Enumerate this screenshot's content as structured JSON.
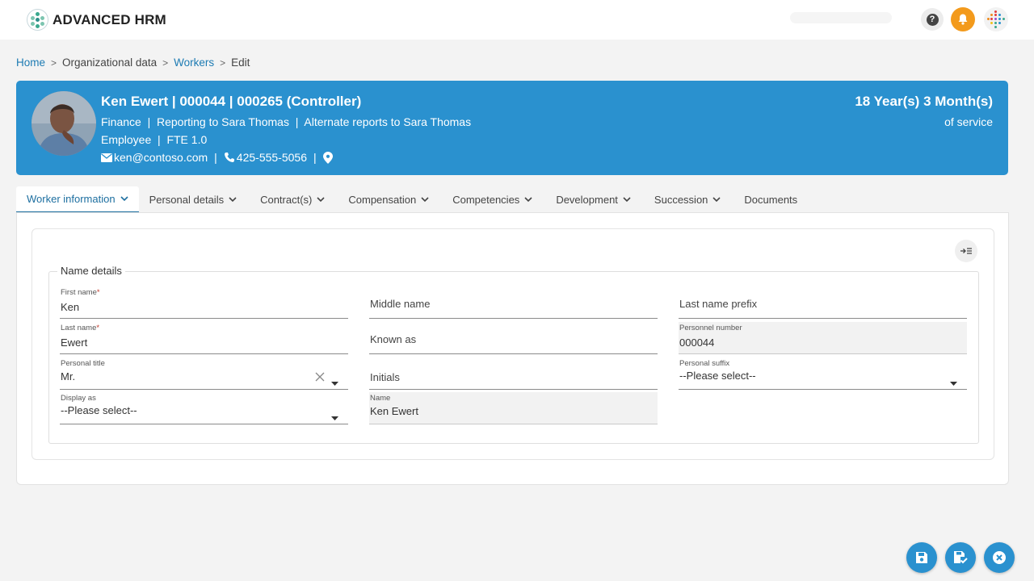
{
  "app": {
    "name": "ADVANCED HRM"
  },
  "topbar": {
    "help_icon": "question-icon",
    "notification_icon": "bell-icon",
    "apps_icon": "dot-grid-icon",
    "bell_color": "#f39a1c"
  },
  "breadcrumb": [
    {
      "label": "Home"
    },
    {
      "label": "Organizational data"
    },
    {
      "label": "Workers"
    },
    {
      "label": "Edit"
    }
  ],
  "worker": {
    "title": "Ken Ewert | 000044 | 000265 (Controller)",
    "org_line": "Finance  |  Reporting to Sara Thomas  |  Alternate reports to Sara Thomas",
    "type_line": "Employee  |  FTE 1.0",
    "email": "ken@contoso.com",
    "phone": "425-555-5056",
    "service_length": "18 Year(s) 3 Month(s)",
    "service_caption": "of service",
    "header_color": "#2a91cf"
  },
  "tabs": [
    {
      "label": "Worker information",
      "active": true
    },
    {
      "label": "Personal details"
    },
    {
      "label": "Contract(s)"
    },
    {
      "label": "Compensation"
    },
    {
      "label": "Competencies"
    },
    {
      "label": "Development"
    },
    {
      "label": "Succession"
    },
    {
      "label": "Documents"
    }
  ],
  "section": {
    "legend": "Name details",
    "fields": {
      "first_name": {
        "label": "First name",
        "value": "Ken",
        "required": "*"
      },
      "middle_name": {
        "placeholder": "Middle name"
      },
      "last_name_prefix": {
        "placeholder": "Last name prefix"
      },
      "last_name": {
        "label": "Last name",
        "value": "Ewert",
        "required": "*"
      },
      "known_as": {
        "placeholder": "Known as"
      },
      "personnel_number": {
        "label": "Personnel number",
        "value": "000044"
      },
      "personal_title": {
        "label": "Personal title",
        "value": "Mr."
      },
      "initials": {
        "placeholder": "Initials"
      },
      "personal_suffix": {
        "label": "Personal suffix",
        "value": "--Please select--"
      },
      "display_as": {
        "label": "Display as",
        "value": "--Please select--"
      },
      "name": {
        "label": "Name",
        "value": "Ken Ewert"
      }
    }
  },
  "actions": {
    "save_icon": "save-icon",
    "save_close_icon": "save-check-icon",
    "cancel_icon": "close-circle-icon"
  }
}
